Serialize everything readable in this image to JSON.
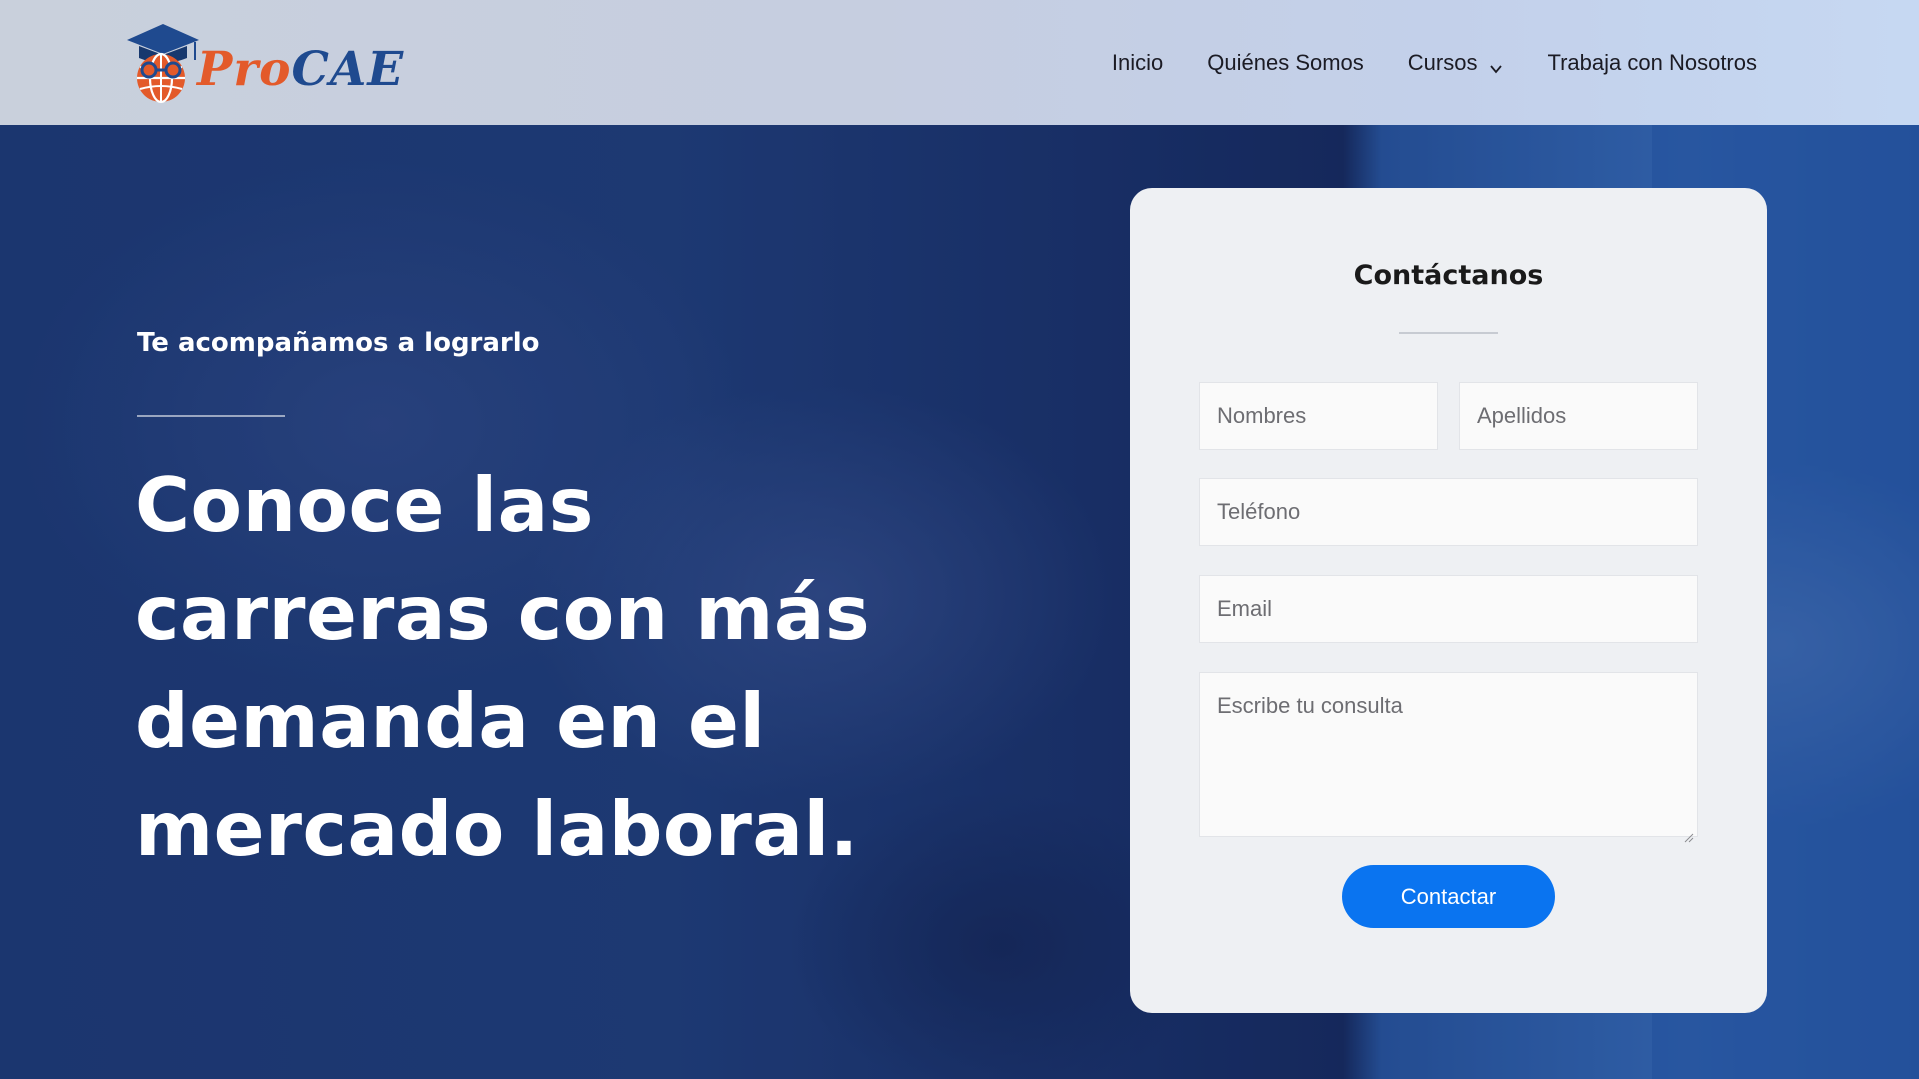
{
  "brand": {
    "logo_part1": "Pro",
    "logo_part2": "CAE",
    "colors": {
      "accent_orange": "#e35a2a",
      "accent_blue": "#1f4a8f"
    }
  },
  "nav": {
    "items": [
      {
        "label": "Inicio"
      },
      {
        "label": "Quiénes Somos"
      },
      {
        "label": "Cursos",
        "icon": "chevron-down-icon"
      },
      {
        "label": "Trabaja con Nosotros"
      }
    ]
  },
  "hero": {
    "kicker": "Te acompañamos a lograrlo",
    "headline": "Conoce las carreras con más demanda en el mercado laboral."
  },
  "contact_form": {
    "title": "Contáctanos",
    "fields": {
      "nombres": {
        "placeholder": "Nombres",
        "value": ""
      },
      "apellidos": {
        "placeholder": "Apellidos",
        "value": ""
      },
      "telefono": {
        "placeholder": "Teléfono",
        "value": ""
      },
      "email": {
        "placeholder": "Email",
        "value": ""
      },
      "consulta": {
        "placeholder": "Escribe tu consulta",
        "value": ""
      }
    },
    "submit_label": "Contactar",
    "submit_color": "#0a74f0"
  }
}
